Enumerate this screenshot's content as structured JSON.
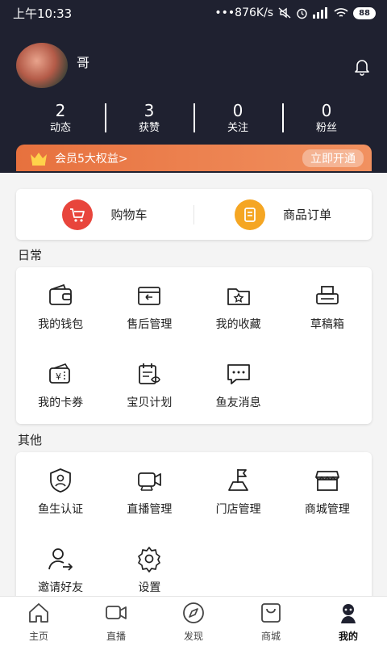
{
  "status_bar": {
    "time": "上午10:33",
    "network_speed": "•••876K/s",
    "battery": "88"
  },
  "profile": {
    "username": "哥"
  },
  "stats": [
    {
      "value": "2",
      "label": "动态"
    },
    {
      "value": "3",
      "label": "获赞"
    },
    {
      "value": "0",
      "label": "关注"
    },
    {
      "value": "0",
      "label": "粉丝"
    }
  ],
  "vip": {
    "text": "会员5大权益>",
    "button": "立即开通"
  },
  "quick": {
    "cart": "购物车",
    "orders": "商品订单"
  },
  "daily": {
    "title": "日常",
    "items": [
      {
        "label": "我的钱包",
        "icon": "wallet-icon"
      },
      {
        "label": "售后管理",
        "icon": "return-box-icon"
      },
      {
        "label": "我的收藏",
        "icon": "star-folder-icon"
      },
      {
        "label": "草稿箱",
        "icon": "printer-icon"
      },
      {
        "label": "我的卡券",
        "icon": "coupon-icon"
      },
      {
        "label": "宝贝计划",
        "icon": "calendar-plan-icon"
      },
      {
        "label": "鱼友消息",
        "icon": "chat-icon"
      }
    ]
  },
  "other": {
    "title": "其他",
    "items": [
      {
        "label": "鱼生认证",
        "icon": "shield-user-icon"
      },
      {
        "label": "直播管理",
        "icon": "camera-icon"
      },
      {
        "label": "门店管理",
        "icon": "flag-icon"
      },
      {
        "label": "商城管理",
        "icon": "store-icon"
      },
      {
        "label": "邀请好友",
        "icon": "invite-user-icon"
      },
      {
        "label": "设置",
        "icon": "gear-icon"
      }
    ]
  },
  "tabs": [
    {
      "label": "主页",
      "icon": "home-icon"
    },
    {
      "label": "直播",
      "icon": "video-icon"
    },
    {
      "label": "发现",
      "icon": "compass-icon"
    },
    {
      "label": "商城",
      "icon": "shop-icon"
    },
    {
      "label": "我的",
      "icon": "profile-icon",
      "active": true
    }
  ],
  "colors": {
    "header_bg": "#1f2130",
    "vip_orange": "#e7713e",
    "cart_red": "#e8453c",
    "order_yellow": "#f5a623"
  }
}
